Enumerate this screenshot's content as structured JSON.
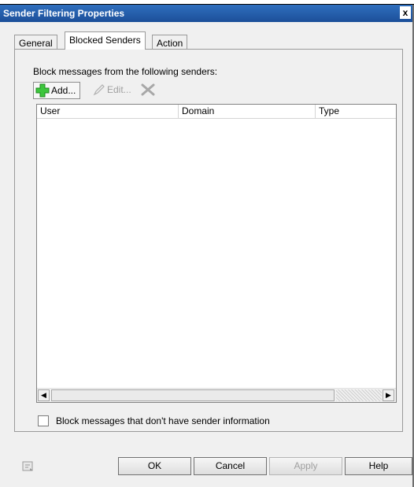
{
  "window": {
    "title": "Sender Filtering Properties",
    "close_glyph": "x"
  },
  "tabs": [
    {
      "label": "General",
      "active": false
    },
    {
      "label": "Blocked Senders",
      "active": true
    },
    {
      "label": "Action",
      "active": false
    }
  ],
  "panel": {
    "section_label": "Block messages from the following senders:",
    "toolbar": {
      "add_label": "Add...",
      "edit_label": "Edit...",
      "add_icon": "plus-icon",
      "edit_icon": "pencil-icon",
      "delete_icon": "delete-x-icon"
    },
    "list": {
      "columns": [
        "User",
        "Domain",
        "Type"
      ],
      "rows": []
    },
    "checkbox": {
      "label": "Block messages that don't have sender information",
      "checked": false
    }
  },
  "buttons": {
    "ok": "OK",
    "cancel": "Cancel",
    "apply": "Apply",
    "help": "Help"
  },
  "colors": {
    "titlebar": "#1c4f99",
    "add_icon": "#3cc63c",
    "delete_icon": "#a8a8a8"
  }
}
